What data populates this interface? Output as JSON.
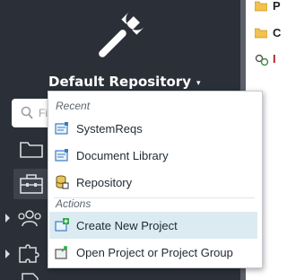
{
  "repository": {
    "title": "Default Repository",
    "caret": "▾"
  },
  "search": {
    "placeholder": "Fi"
  },
  "menu": {
    "recent_header": "Recent",
    "recent_items": [
      {
        "label": "SystemReqs",
        "icon": "project-icon"
      },
      {
        "label": "Document Library",
        "icon": "project-icon"
      },
      {
        "label": "Repository",
        "icon": "database-icon"
      }
    ],
    "actions_header": "Actions",
    "action_items": [
      {
        "label": "Create New Project",
        "icon": "new-project-icon",
        "highlighted": true
      },
      {
        "label": "Open Project or Project Group",
        "icon": "open-project-icon"
      }
    ]
  },
  "right_pane": {
    "rows": [
      {
        "icon": "folder-icon",
        "label": "P"
      },
      {
        "icon": "folder-icon",
        "label": "C"
      },
      {
        "icon": "link-icon",
        "label": "I"
      }
    ]
  },
  "colors": {
    "sidebar_bg": "#2b3038",
    "highlight": "#dcebf1",
    "folder": "#f2c14e"
  }
}
